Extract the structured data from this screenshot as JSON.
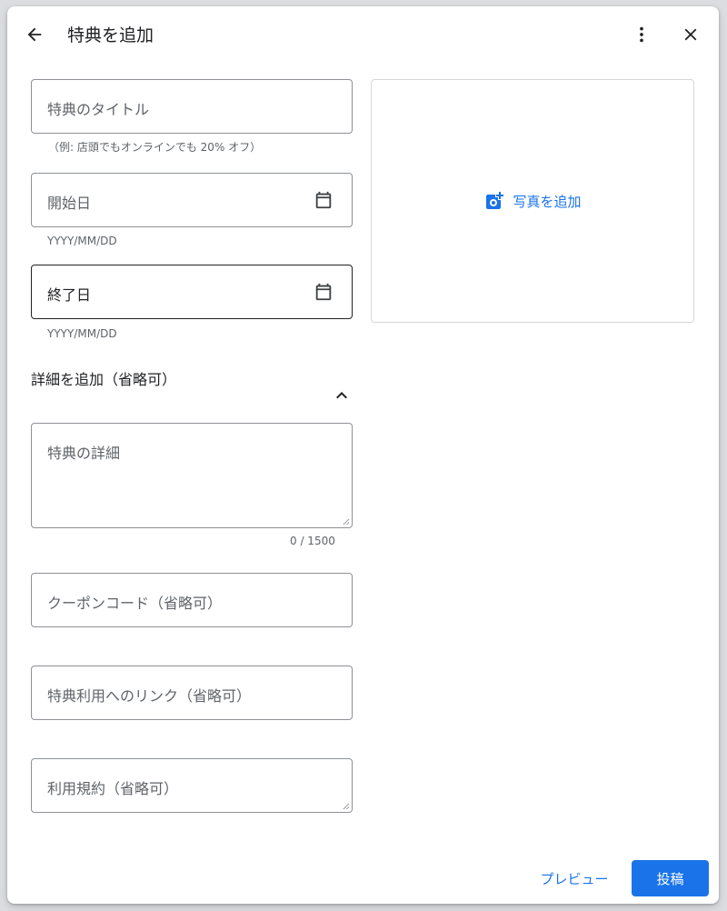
{
  "dialog": {
    "title": "特典を追加",
    "back_icon": "arrow-back-icon",
    "more_icon": "more-vert-icon",
    "close_icon": "close-icon"
  },
  "form": {
    "title_field": {
      "placeholder": "特典のタイトル",
      "helper": "（例: 店頭でもオンラインでも 20% オフ）"
    },
    "start_date": {
      "placeholder": "開始日",
      "helper": "YYYY/MM/DD",
      "icon": "calendar-icon"
    },
    "end_date": {
      "placeholder": "終了日",
      "helper": "YYYY/MM/DD",
      "icon": "calendar-icon"
    },
    "details_section": {
      "title": "詳細を追加（省略可）",
      "icon": "chevron-up-icon"
    },
    "details_field": {
      "placeholder": "特典の詳細",
      "counter": "0 / 1500"
    },
    "coupon_field": {
      "placeholder": "クーポンコード（省略可）"
    },
    "link_field": {
      "placeholder": "特典利用へのリンク（省略可）"
    },
    "terms_field": {
      "placeholder": "利用規約（省略可）"
    }
  },
  "photo": {
    "label": "写真を追加",
    "icon": "add-photo-icon"
  },
  "footer": {
    "preview_label": "プレビュー",
    "post_label": "投稿"
  },
  "colors": {
    "accent": "#1a73e8",
    "border": "#8e9196",
    "text": "#202124",
    "muted": "#5f6368"
  }
}
